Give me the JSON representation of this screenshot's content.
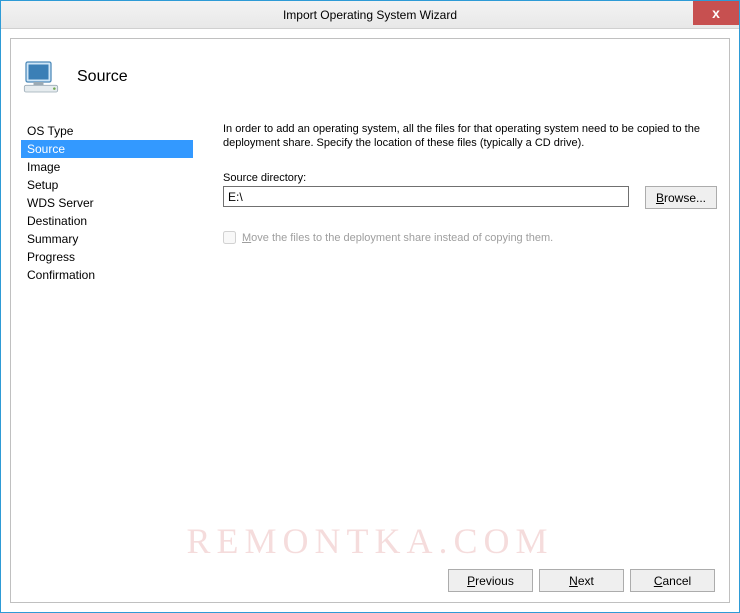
{
  "window": {
    "title": "Import Operating System Wizard",
    "close_glyph": "x"
  },
  "header": {
    "title": "Source"
  },
  "nav": {
    "items": [
      {
        "label": "OS Type",
        "selected": false
      },
      {
        "label": "Source",
        "selected": true
      },
      {
        "label": "Image",
        "selected": false
      },
      {
        "label": "Setup",
        "selected": false
      },
      {
        "label": "WDS Server",
        "selected": false
      },
      {
        "label": "Destination",
        "selected": false
      },
      {
        "label": "Summary",
        "selected": false
      },
      {
        "label": "Progress",
        "selected": false
      },
      {
        "label": "Confirmation",
        "selected": false
      }
    ]
  },
  "main": {
    "instruction": "In order to add an operating system, all the files for that operating system need to be copied to the deployment share.  Specify the location of these files (typically a CD drive).",
    "source_label": "Source directory:",
    "source_value": "E:\\",
    "browse_label": "Browse...",
    "move_checkbox_label": "Move the files to the deployment share instead of copying them.",
    "move_checkbox_checked": false,
    "move_checkbox_enabled": false
  },
  "footer": {
    "previous": "Previous",
    "next": "Next",
    "cancel": "Cancel"
  },
  "watermark": "REMONTKA.COM"
}
